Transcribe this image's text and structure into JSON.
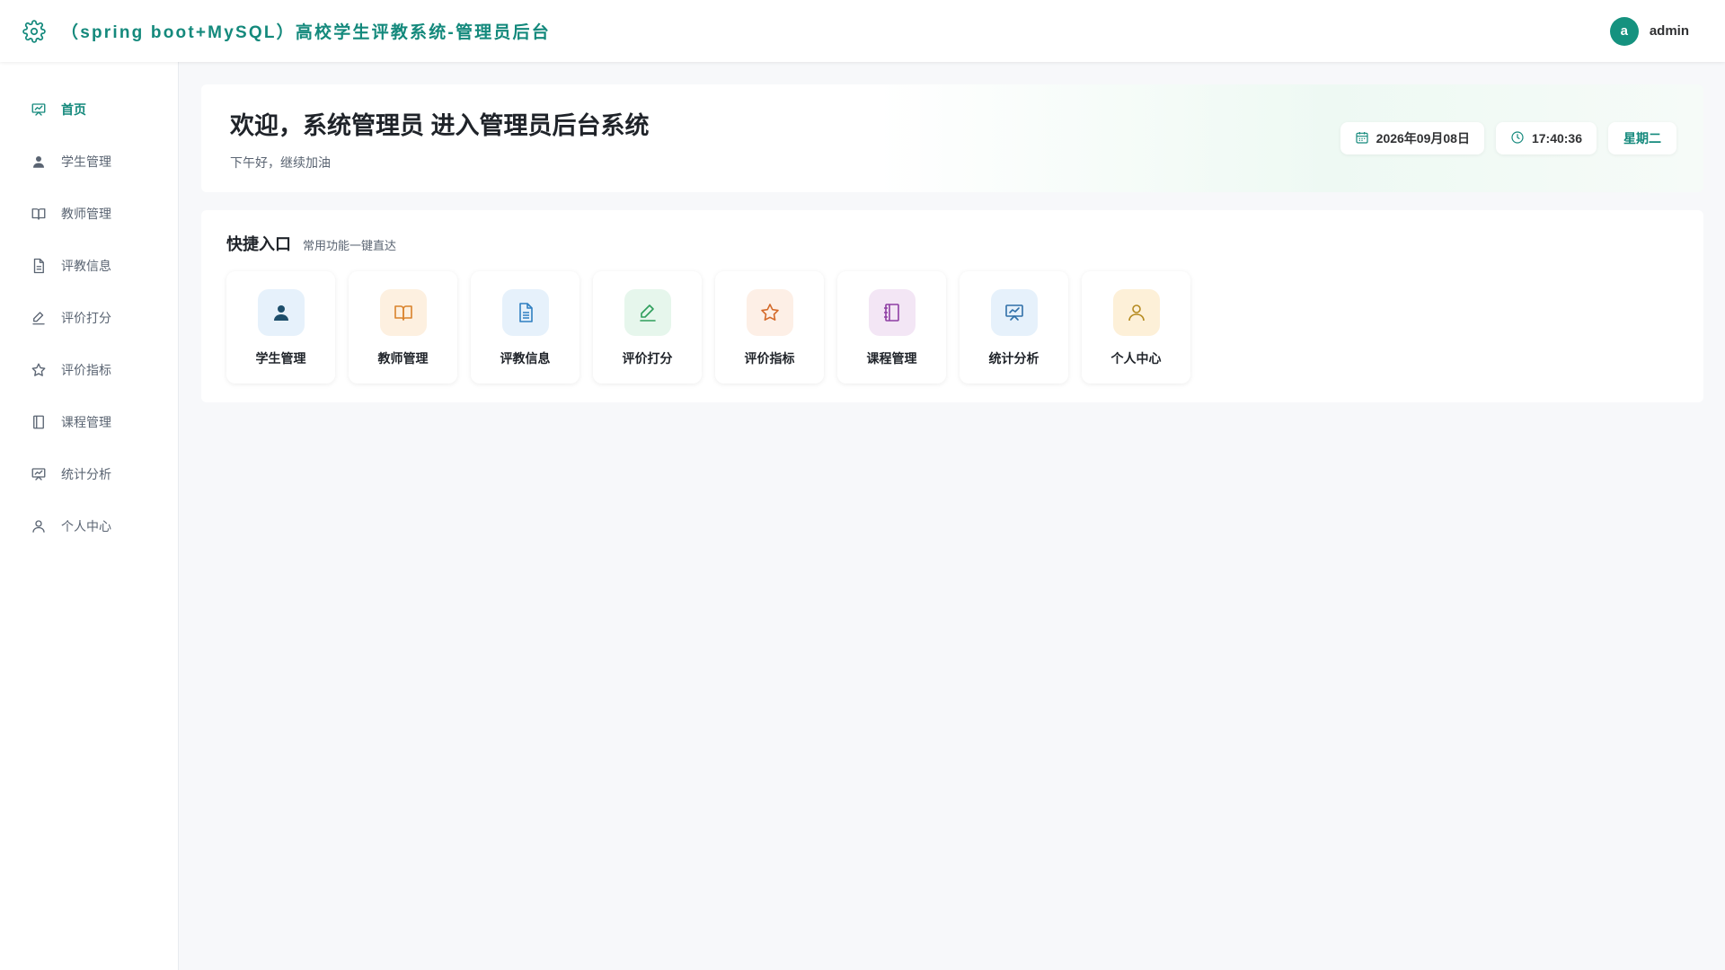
{
  "header": {
    "title": "（spring boot+MySQL）高校学生评教系统-管理员后台",
    "brand_icon": "gear-icon",
    "user": {
      "avatar_letter": "a",
      "name": "admin"
    }
  },
  "sidebar": {
    "items": [
      {
        "label": "首页",
        "icon": "presentation-icon",
        "active": true
      },
      {
        "label": "学生管理",
        "icon": "user-icon"
      },
      {
        "label": "教师管理",
        "icon": "book-icon"
      },
      {
        "label": "评教信息",
        "icon": "document-icon"
      },
      {
        "label": "评价打分",
        "icon": "pencil-icon"
      },
      {
        "label": "评价指标",
        "icon": "star-icon"
      },
      {
        "label": "课程管理",
        "icon": "notebook-icon"
      },
      {
        "label": "统计分析",
        "icon": "presentation-icon"
      },
      {
        "label": "个人中心",
        "icon": "user-outline-icon"
      }
    ]
  },
  "welcome": {
    "title": "欢迎，系统管理员 进入管理员后台系统",
    "subtitle": "下午好，继续加油",
    "date": "2026年09月08日",
    "time": "17:40:36",
    "weekday": "星期二"
  },
  "quick": {
    "title": "快捷入口",
    "subtitle": "常用功能一键直达",
    "tiles": [
      {
        "label": "学生管理",
        "icon": "user-icon",
        "bg": "#e6f1fb",
        "fg": "#1d4e6b"
      },
      {
        "label": "教师管理",
        "icon": "book-icon",
        "bg": "#fdf0e0",
        "fg": "#d9822b"
      },
      {
        "label": "评教信息",
        "icon": "document-icon",
        "bg": "#e6f1fb",
        "fg": "#2f7fc1"
      },
      {
        "label": "评价打分",
        "icon": "pencil-icon",
        "bg": "#e6f6ec",
        "fg": "#2e9e5b"
      },
      {
        "label": "评价指标",
        "icon": "star-icon",
        "bg": "#fdefe6",
        "fg": "#d46a2a"
      },
      {
        "label": "课程管理",
        "icon": "notebook-icon",
        "bg": "#f3e6f5",
        "fg": "#8e3ea3"
      },
      {
        "label": "统计分析",
        "icon": "presentation-icon",
        "bg": "#e6f1fb",
        "fg": "#2f6fa8"
      },
      {
        "label": "个人中心",
        "icon": "user-outline-icon",
        "bg": "#fdf0d8",
        "fg": "#b58a1e"
      }
    ]
  },
  "colors": {
    "accent": "#14897c",
    "text": "#303133",
    "muted": "#5a6472"
  }
}
